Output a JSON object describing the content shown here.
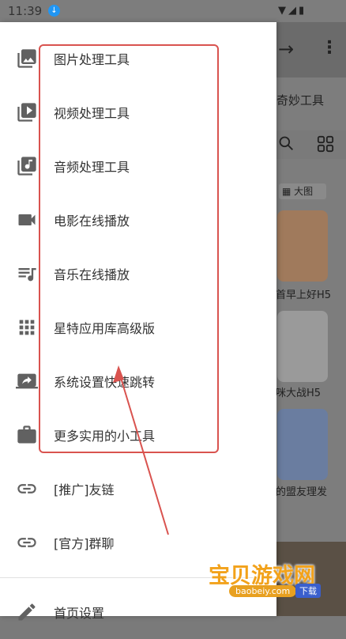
{
  "status_bar": {
    "time": "11:39"
  },
  "background_app": {
    "subtitle": "奇妙工具",
    "view_toggle": "大图",
    "cards": [
      "首早上好H5",
      "咪大战H5",
      "的盟友理发"
    ]
  },
  "drawer": {
    "items": [
      {
        "label": "图片处理工具",
        "icon": "photo-library-icon"
      },
      {
        "label": "视频处理工具",
        "icon": "video-library-icon"
      },
      {
        "label": "音频处理工具",
        "icon": "audio-library-icon"
      },
      {
        "label": "电影在线播放",
        "icon": "videocam-icon"
      },
      {
        "label": "音乐在线播放",
        "icon": "playlist-music-icon"
      },
      {
        "label": "星特应用库高级版",
        "icon": "apps-grid-icon"
      },
      {
        "label": "系统设置快速跳转",
        "icon": "screen-share-icon"
      },
      {
        "label": "更多实用的小工具",
        "icon": "briefcase-icon"
      },
      {
        "label": "[推广]友链",
        "icon": "link-icon"
      },
      {
        "label": "[官方]群聊",
        "icon": "link-icon"
      },
      {
        "label": "首页设置",
        "icon": "edit-icon"
      }
    ]
  },
  "watermark": {
    "title": "宝贝游戏网",
    "url": "baobeiy.com",
    "button": "下载"
  },
  "colors": {
    "annotation": "#d9534f",
    "icon": "#616161",
    "text": "#333333"
  }
}
